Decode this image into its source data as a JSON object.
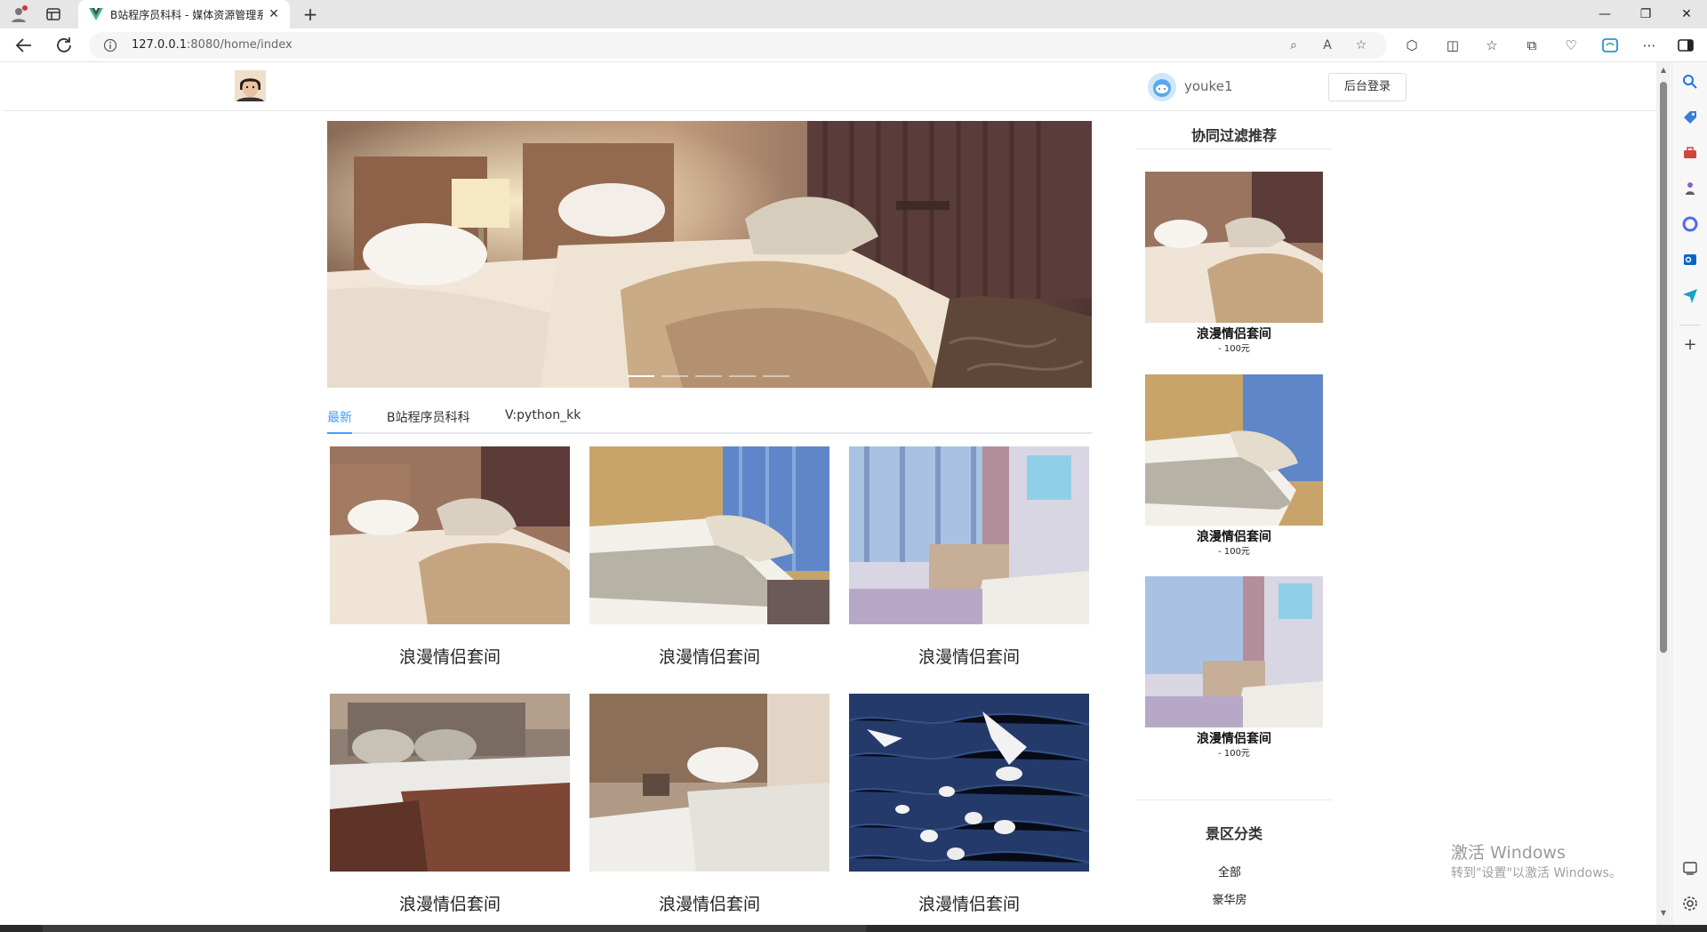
{
  "browser": {
    "tab_title": "B站程序员科科 - 媒体资源管理系",
    "tab_close": "✕",
    "new_tab": "+",
    "address_host": "127.0.0.1",
    "address_path": ":8080/home/index",
    "icons": {
      "profile": "profile-icon",
      "workspaces": "workspaces-icon",
      "favicon": "vue-favicon-icon",
      "back": "back-arrow-icon",
      "refresh": "refresh-icon",
      "info": "site-info-icon",
      "reader": "immersive-reader-icon",
      "read_aloud": "read-aloud-icon",
      "favorite_star": "star-icon",
      "extensions": "extensions-icon",
      "split": "split-screen-icon",
      "favorites": "favorites-icon",
      "collections": "collections-icon",
      "performance": "performance-icon",
      "copilot": "copilot-icon",
      "more": "more-icon",
      "sidebar_toggle": "sidebar-toggle-icon"
    },
    "window_controls": {
      "minimize": "—",
      "restore": "❐",
      "close": "✕"
    }
  },
  "header": {
    "logo": "site-logo",
    "username": "youke1",
    "login_button": "后台登录"
  },
  "carousel": {
    "slide_count": 5,
    "active_index": 0
  },
  "tabs": [
    {
      "label": "最新",
      "active": true
    },
    {
      "label": "B站程序员科科",
      "active": false
    },
    {
      "label": "V:python_kk",
      "active": false
    }
  ],
  "cards": [
    {
      "title": "浪漫情侣套间",
      "image": "twin-bed-hotel-room"
    },
    {
      "title": "浪漫情侣套间",
      "image": "bed-and-armchair-room"
    },
    {
      "title": "浪漫情侣套间",
      "image": "room-with-sofa-chairs"
    },
    {
      "title": "浪漫情侣套间",
      "image": "twin-beds-brown-throws"
    },
    {
      "title": "浪漫情侣套间",
      "image": "white-beds-wood-panel"
    },
    {
      "title": "浪漫情侣套间",
      "image": "seagulls-on-water"
    }
  ],
  "recommend": {
    "heading": "协同过滤推荐",
    "items": [
      {
        "name": "浪漫情侣套间",
        "price": "- 100元"
      },
      {
        "name": "浪漫情侣套间",
        "price": "- 100元"
      },
      {
        "name": "浪漫情侣套间",
        "price": "- 100元"
      }
    ]
  },
  "categories": {
    "heading": "景区分类",
    "items": [
      "全部",
      "豪华房"
    ]
  },
  "watermark": {
    "title": "激活 Windows",
    "subtitle": "转到\"设置\"以激活 Windows。"
  },
  "colors": {
    "accent": "#409eff",
    "tab_border": "#e4e7ed"
  }
}
